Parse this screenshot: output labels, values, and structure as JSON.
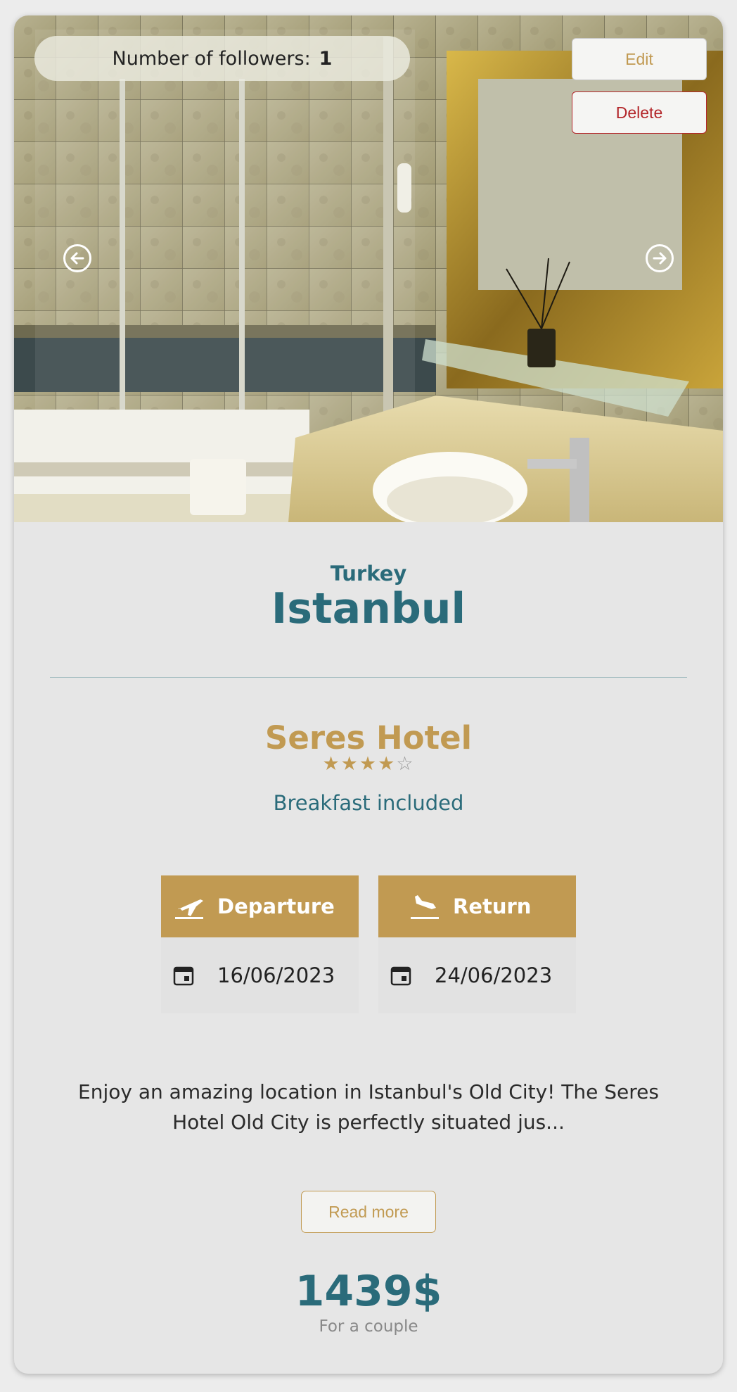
{
  "header": {
    "followers_label": "Number of followers:",
    "followers_count": "1",
    "edit_label": "Edit",
    "delete_label": "Delete"
  },
  "destination": {
    "country": "Turkey",
    "city": "Istanbul"
  },
  "hotel": {
    "name": "Seres Hotel",
    "rating": 4,
    "max_rating": 5,
    "board": "Breakfast included"
  },
  "flights": {
    "departure_label": "Departure",
    "departure_date": "16/06/2023",
    "return_label": "Return",
    "return_date": "24/06/2023"
  },
  "description": "Enjoy an amazing location in Istanbul's Old City! The Seres Hotel Old City is perfectly situated jus...",
  "read_more_label": "Read more",
  "price": {
    "amount": "1439$",
    "note": "For a couple"
  },
  "colors": {
    "accent": "#c19a52",
    "primary": "#2a6b7a",
    "danger": "#b3262a"
  },
  "icons": [
    "arrow-left-circle-icon",
    "arrow-right-circle-icon",
    "plane-takeoff-icon",
    "plane-landing-icon",
    "calendar-icon",
    "star-icon"
  ]
}
